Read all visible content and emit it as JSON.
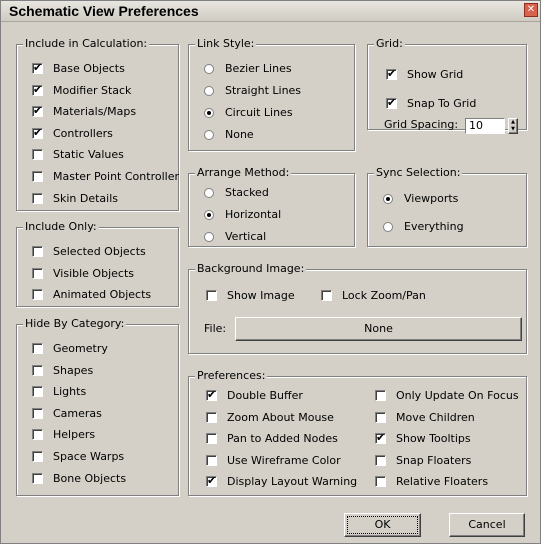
{
  "window": {
    "title": "Schematic View Preferences",
    "close_glyph": "✕"
  },
  "include_calc": {
    "title": "Include in Calculation:",
    "items": [
      {
        "label": "Base Objects",
        "checked": true
      },
      {
        "label": "Modifier Stack",
        "checked": true
      },
      {
        "label": "Materials/Maps",
        "checked": true
      },
      {
        "label": "Controllers",
        "checked": true
      },
      {
        "label": "Static Values",
        "checked": false
      },
      {
        "label": "Master Point Controller",
        "checked": false
      },
      {
        "label": "Skin Details",
        "checked": false
      }
    ]
  },
  "include_only": {
    "title": "Include Only:",
    "items": [
      {
        "label": "Selected Objects",
        "checked": false
      },
      {
        "label": "Visible Objects",
        "checked": false
      },
      {
        "label": "Animated Objects",
        "checked": false
      }
    ]
  },
  "hide_by_category": {
    "title": "Hide By Category:",
    "items": [
      {
        "label": "Geometry",
        "checked": false
      },
      {
        "label": "Shapes",
        "checked": false
      },
      {
        "label": "Lights",
        "checked": false
      },
      {
        "label": "Cameras",
        "checked": false
      },
      {
        "label": "Helpers",
        "checked": false
      },
      {
        "label": "Space Warps",
        "checked": false
      },
      {
        "label": "Bone Objects",
        "checked": false
      }
    ]
  },
  "link_style": {
    "title": "Link Style:",
    "items": [
      {
        "label": "Bezier Lines",
        "selected": false
      },
      {
        "label": "Straight Lines",
        "selected": false
      },
      {
        "label": "Circuit Lines",
        "selected": true
      },
      {
        "label": "None",
        "selected": false
      }
    ]
  },
  "arrange_method": {
    "title": "Arrange Method:",
    "items": [
      {
        "label": "Stacked",
        "selected": false
      },
      {
        "label": "Horizontal",
        "selected": true
      },
      {
        "label": "Vertical",
        "selected": false
      }
    ]
  },
  "grid": {
    "title": "Grid:",
    "show_grid": {
      "label": "Show Grid",
      "checked": true
    },
    "snap_to_grid": {
      "label": "Snap To Grid",
      "checked": true
    },
    "spacing_label": "Grid Spacing:",
    "spacing_value": "10"
  },
  "sync_selection": {
    "title": "Sync Selection:",
    "items": [
      {
        "label": "Viewports",
        "selected": true
      },
      {
        "label": "Everything",
        "selected": false
      }
    ]
  },
  "background_image": {
    "title": "Background Image:",
    "show_image": {
      "label": "Show Image",
      "checked": false
    },
    "lock_zoom": {
      "label": "Lock Zoom/Pan",
      "checked": false
    },
    "file_label": "File:",
    "file_button": "None"
  },
  "preferences": {
    "title": "Preferences:",
    "left": [
      {
        "label": "Double Buffer",
        "checked": true
      },
      {
        "label": "Zoom About Mouse",
        "checked": false
      },
      {
        "label": "Pan to Added Nodes",
        "checked": false
      },
      {
        "label": "Use Wireframe Color",
        "checked": false
      },
      {
        "label": "Display Layout Warning",
        "checked": true
      }
    ],
    "right": [
      {
        "label": "Only Update On Focus",
        "checked": false
      },
      {
        "label": "Move Children",
        "checked": false
      },
      {
        "label": "Show Tooltips",
        "checked": true
      },
      {
        "label": "Snap Floaters",
        "checked": false
      },
      {
        "label": "Relative Floaters",
        "checked": false
      }
    ]
  },
  "buttons": {
    "ok": "OK",
    "cancel": "Cancel"
  },
  "glyphs": {
    "check": "✔",
    "spin_up": "▲",
    "spin_down": "▼"
  }
}
